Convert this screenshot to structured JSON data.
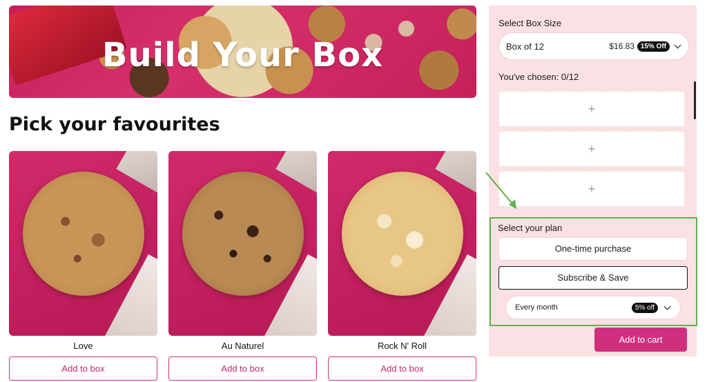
{
  "hero": {
    "title": "Build Your Box"
  },
  "section_title": "Pick your favourites",
  "products": [
    {
      "name": "Love",
      "button": "Add to box"
    },
    {
      "name": "Au Naturel",
      "button": "Add to box"
    },
    {
      "name": "Rock N' Roll",
      "button": "Add to box"
    }
  ],
  "sidebar": {
    "box_size_label": "Select Box Size",
    "box_select": {
      "value": "Box of 12",
      "price": "$16.83",
      "discount": "15% Off"
    },
    "chosen_label": "You've chosen:",
    "chosen_count": "0/12",
    "slot_symbol": "+",
    "plan_label": "Select your plan",
    "plan_options": [
      "One-time purchase",
      "Subscribe & Save"
    ],
    "frequency": {
      "value": "Every month",
      "discount": "5% off"
    },
    "cart_button": "Add to cart"
  },
  "colors": {
    "accent": "#d02f80",
    "sidebar_bg": "#fbe1e4",
    "highlight_border": "#5db14b"
  },
  "icons": [
    "chevron-down-icon",
    "plus-icon",
    "annotation-arrow-icon"
  ]
}
